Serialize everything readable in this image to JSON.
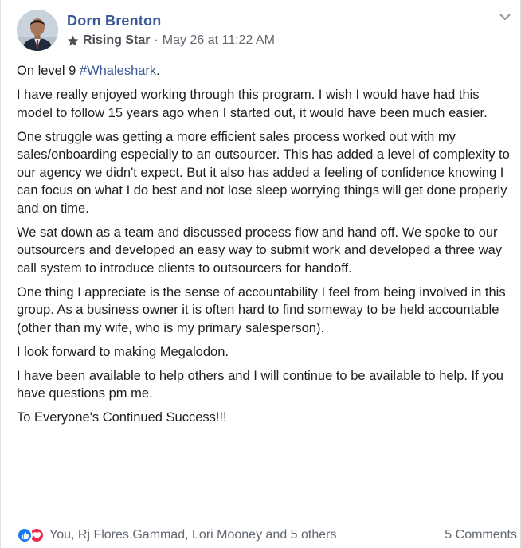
{
  "post": {
    "author": "Dorn Brenton",
    "badge": "Rising Star",
    "separator": "·",
    "timestamp": "May 26 at 11:22 AM",
    "paragraph_1_prefix": "On level 9 ",
    "hashtag": "#Whaleshark",
    "paragraph_1_suffix": ".",
    "paragraphs": [
      "I have really enjoyed working through this program. I wish I would have had this model to follow 15 years ago when I started out, it would have been much easier.",
      "One struggle was getting a more efficient sales process worked out with my sales/onboarding especially to an outsourcer. This has added a level of complexity to our agency we didn't expect. But it also has added a feeling of confidence knowing I can focus on what I do best and not lose sleep worrying things will get done properly and on time.",
      "We sat down as a team and discussed process flow and hand off. We spoke to our outsourcers and developed an easy way to submit work and developed a three way call system to introduce clients to outsourcers for handoff.",
      "One thing I appreciate is the sense of accountability I feel from being involved in this group. As a business owner it is often hard to find someway to be held accountable (other than my wife, who is my primary salesperson).",
      "I look forward to making Megalodon.",
      "I have been available to help others and I will continue to be available to help. If you have questions pm me.",
      "To Everyone's Continued Success!!!"
    ]
  },
  "footer": {
    "reactions_text": "You, Rj Flores Gammad, Lori Mooney and 5 others",
    "comments": "5 Comments"
  },
  "icons": {
    "badge": "star-icon",
    "menu": "chevron-down-icon",
    "reaction_1": "like-icon",
    "reaction_2": "love-icon"
  },
  "colors": {
    "link": "#385898",
    "text": "#1c1e21",
    "secondary": "#606770",
    "like": "#1877f2",
    "love": "#f0284a"
  }
}
